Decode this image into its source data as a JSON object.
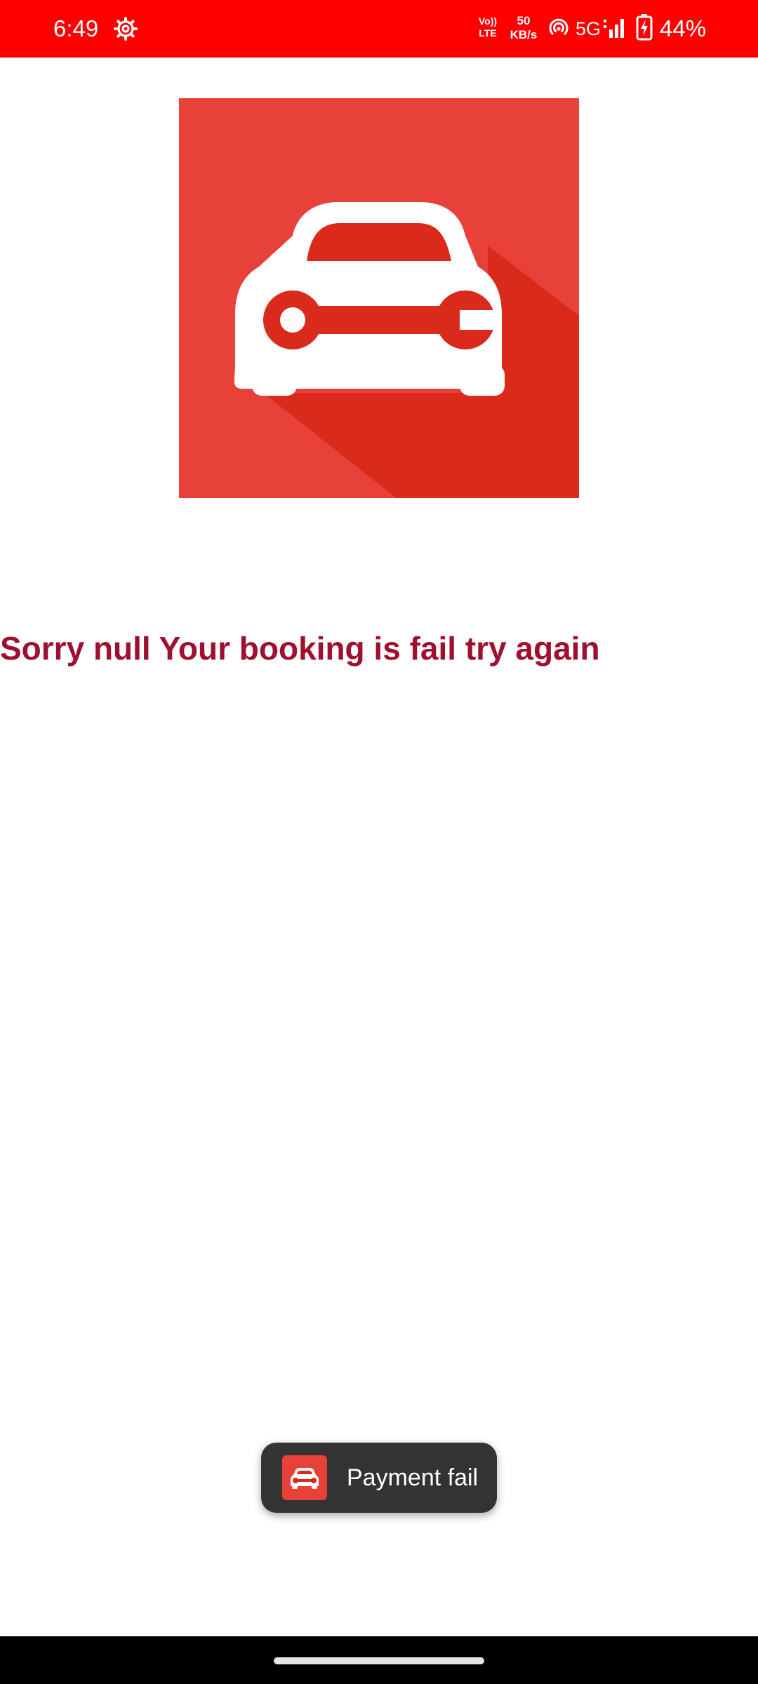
{
  "status_bar": {
    "time": "6:49",
    "volte_top": "Vo))",
    "volte_bottom": "LTE",
    "net_speed_value": "50",
    "net_speed_unit": "KB/s",
    "network_type": "5G",
    "battery_percent": "44%",
    "background_color": "#ff0000"
  },
  "logo": {
    "icon": "car-wrench-icon",
    "background_color": "#e8413a",
    "shadow_color": "#d92a1c"
  },
  "message": {
    "text": "Sorry null Your booking is fail try again",
    "color": "#a0102e"
  },
  "toast": {
    "icon": "car-icon",
    "text": "Payment fail",
    "background_color": "#333333"
  }
}
